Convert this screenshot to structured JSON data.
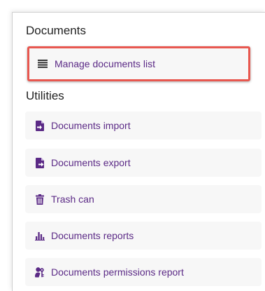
{
  "documents_section": {
    "title": "Documents",
    "items": [
      {
        "label": "Manage documents list",
        "icon": "list-icon"
      }
    ]
  },
  "utilities_section": {
    "title": "Utilities",
    "items": [
      {
        "label": "Documents import",
        "icon": "file-import-icon"
      },
      {
        "label": "Documents export",
        "icon": "file-export-icon"
      },
      {
        "label": "Trash can",
        "icon": "trash-icon"
      },
      {
        "label": "Documents reports",
        "icon": "bar-chart-icon"
      },
      {
        "label": "Documents permissions report",
        "icon": "user-key-icon"
      }
    ]
  },
  "colors": {
    "link": "#5b2a86",
    "highlight_border": "#e8574f",
    "item_background": "#f7f7f7"
  }
}
